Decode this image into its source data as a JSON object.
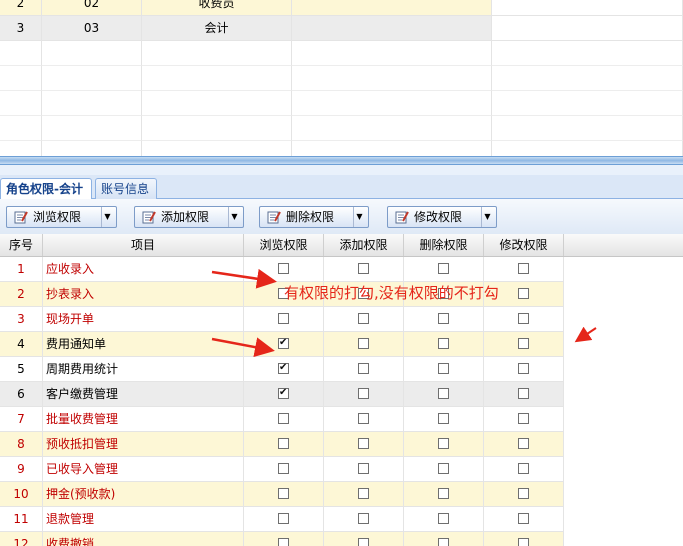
{
  "top_grid": {
    "rows": [
      {
        "seq": "2",
        "code": "02",
        "name": "收费员"
      },
      {
        "seq": "3",
        "code": "03",
        "name": "会计"
      }
    ]
  },
  "tabs": [
    {
      "label": "角色权限-会计",
      "active": true
    },
    {
      "label": "账号信息",
      "active": false
    }
  ],
  "toolbar": {
    "browse_label": "浏览权限",
    "add_label": "添加权限",
    "delete_label": "删除权限",
    "modify_label": "修改权限"
  },
  "table": {
    "headers": [
      "序号",
      "项目",
      "浏览权限",
      "添加权限",
      "删除权限",
      "修改权限"
    ],
    "rows": [
      {
        "seq": "1",
        "item": "应收录入",
        "browse": false,
        "add": false,
        "delete": false,
        "modify": false
      },
      {
        "seq": "2",
        "item": "抄表录入",
        "browse": false,
        "add": false,
        "delete": false,
        "modify": false
      },
      {
        "seq": "3",
        "item": "现场开单",
        "browse": false,
        "add": false,
        "delete": false,
        "modify": false
      },
      {
        "seq": "4",
        "item": "费用通知单",
        "browse": true,
        "add": false,
        "delete": false,
        "modify": false
      },
      {
        "seq": "5",
        "item": "周期费用统计",
        "browse": true,
        "add": false,
        "delete": false,
        "modify": false
      },
      {
        "seq": "6",
        "item": "客户缴费管理",
        "browse": true,
        "add": false,
        "delete": false,
        "modify": false
      },
      {
        "seq": "7",
        "item": "批量收费管理",
        "browse": false,
        "add": false,
        "delete": false,
        "modify": false
      },
      {
        "seq": "8",
        "item": "预收抵扣管理",
        "browse": false,
        "add": false,
        "delete": false,
        "modify": false
      },
      {
        "seq": "9",
        "item": "已收导入管理",
        "browse": false,
        "add": false,
        "delete": false,
        "modify": false
      },
      {
        "seq": "10",
        "item": "押金(预收款)",
        "browse": false,
        "add": false,
        "delete": false,
        "modify": false
      },
      {
        "seq": "11",
        "item": "退款管理",
        "browse": false,
        "add": false,
        "delete": false,
        "modify": false
      },
      {
        "seq": "12",
        "item": "收费撤销",
        "browse": false,
        "add": false,
        "delete": false,
        "modify": false
      }
    ]
  },
  "annotation": {
    "text": "有权限的打勾,没有权限的不打勾",
    "color": "#e5261a"
  }
}
